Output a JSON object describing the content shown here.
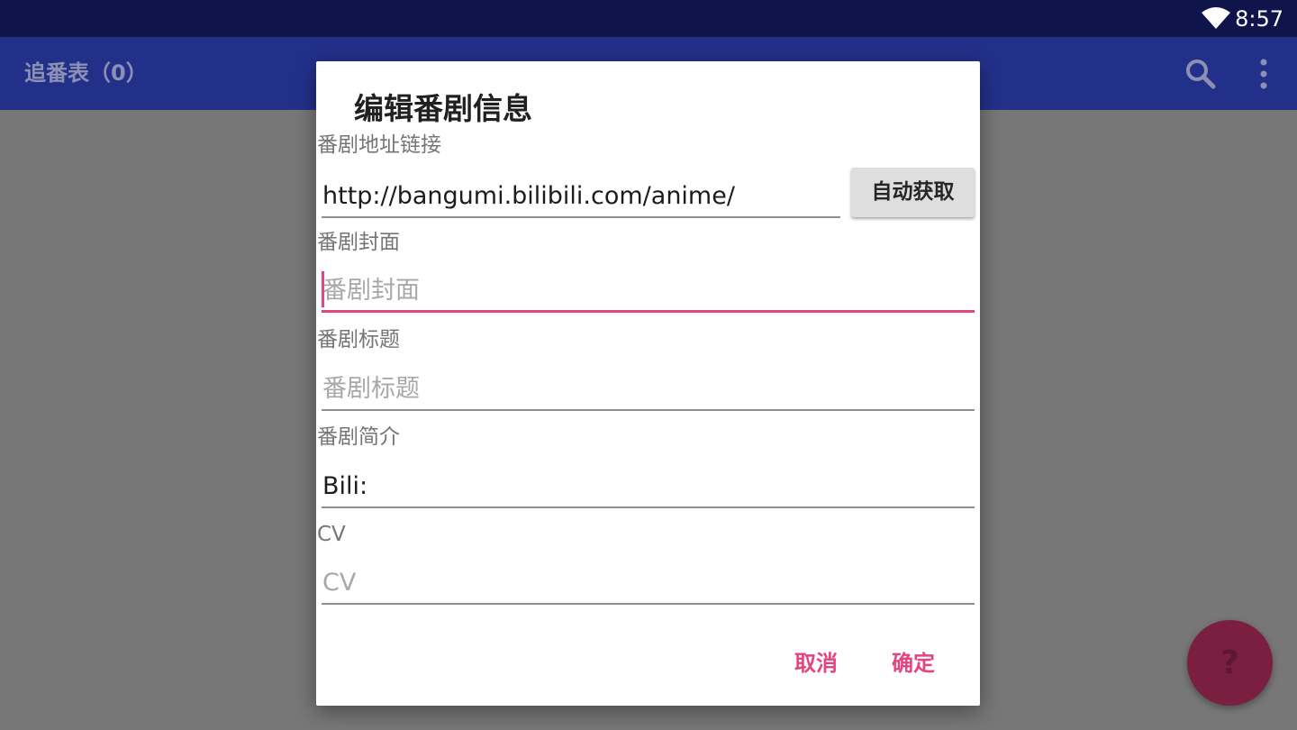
{
  "status_bar": {
    "time": "8:57",
    "wifi_icon": "wifi-icon"
  },
  "app_bar": {
    "title": "追番表（0）",
    "search_icon": "search-icon",
    "more_icon": "more-vert-icon"
  },
  "fab": {
    "label": "?"
  },
  "dialog": {
    "title": "编辑番剧信息",
    "url": {
      "label": "番剧地址链接",
      "value": "http://bangumi.bilibili.com/anime/",
      "placeholder": ""
    },
    "fetch_button": "自动获取",
    "cover": {
      "label": "番剧封面",
      "value": "",
      "placeholder": "番剧封面"
    },
    "name": {
      "label": "番剧标题",
      "value": "",
      "placeholder": "番剧标题"
    },
    "intro": {
      "label": "番剧简介",
      "value": "Bili:",
      "placeholder": ""
    },
    "cv": {
      "label": "CV",
      "value": "",
      "placeholder": "CV"
    },
    "cancel": "取消",
    "confirm": "确定"
  },
  "colors": {
    "accent": "#e2457f",
    "primary": "#23308a",
    "status": "#0f154b"
  }
}
